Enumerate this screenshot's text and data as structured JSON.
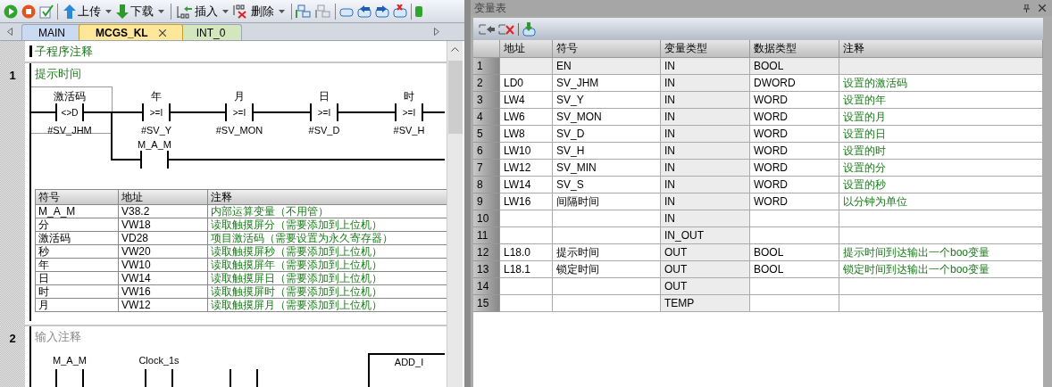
{
  "toolbar": {
    "buttons": [
      {
        "label": "上传"
      },
      {
        "label": "下载"
      },
      {
        "label": "插入"
      },
      {
        "label": "删除"
      }
    ]
  },
  "tabs": [
    {
      "label": "MAIN",
      "selected": false,
      "color": "#c9daf2"
    },
    {
      "label": "MCGS_KL",
      "selected": true,
      "color": "#ffe79a"
    },
    {
      "label": "INT_0",
      "selected": false,
      "color": "#d3e6bd"
    }
  ],
  "editor": {
    "subroutine_comment": "子程序注释",
    "networks": [
      {
        "number": "1",
        "comment": "提示时间",
        "comment_is_default": false,
        "contacts": [
          {
            "top": "激活码",
            "op": "<>D",
            "bottom": "#SV_JHM",
            "selected": true
          },
          {
            "top": "年",
            "op": ">=I",
            "bottom": "#SV_Y",
            "selected": false
          },
          {
            "top": "月",
            "op": ">=I",
            "bottom": "#SV_MON",
            "selected": false
          },
          {
            "top": "日",
            "op": ">=I",
            "bottom": "#SV_D",
            "selected": false
          },
          {
            "top": "时",
            "op": ">=I",
            "bottom": "#SV_H",
            "selected": false
          }
        ],
        "branch_contact": {
          "top": "M_A_M"
        },
        "symbol_table": {
          "columns": [
            "符号",
            "地址",
            "注释"
          ],
          "rows": [
            [
              "M_A_M",
              "V38.2",
              "内部运算变量（不用管）"
            ],
            [
              "分",
              "VW18",
              "读取触摸屏分（需要添加到上位机）"
            ],
            [
              "激活码",
              "VD28",
              "项目激活码（需要设置为永久寄存器）"
            ],
            [
              "秒",
              "VW20",
              "读取触摸屏秒（需要添加到上位机）"
            ],
            [
              "年",
              "VW10",
              "读取触摸屏年（需要添加到上位机）"
            ],
            [
              "日",
              "VW14",
              "读取触摸屏日（需要添加到上位机）"
            ],
            [
              "时",
              "VW16",
              "读取触摸屏时（需要添加到上位机）"
            ],
            [
              "月",
              "VW12",
              "读取触摸屏月（需要添加到上位机）"
            ]
          ]
        }
      },
      {
        "number": "2",
        "comment": "输入注释",
        "comment_is_default": true,
        "contact_labels": [
          "M_A_M",
          "Clock_1s"
        ],
        "box_title": "ADD_I"
      }
    ]
  },
  "variable_table": {
    "title": "变量表",
    "columns": [
      "地址",
      "符号",
      "变量类型",
      "数据类型",
      "注释"
    ],
    "rows": [
      {
        "index": "1",
        "address": "",
        "symbol": "EN",
        "var_type": "IN",
        "data_type": "BOOL",
        "comment": "",
        "editable": false
      },
      {
        "index": "2",
        "address": "LD0",
        "symbol": "SV_JHM",
        "var_type": "IN",
        "data_type": "DWORD",
        "comment": "设置的激活码",
        "editable": true
      },
      {
        "index": "3",
        "address": "LW4",
        "symbol": "SV_Y",
        "var_type": "IN",
        "data_type": "WORD",
        "comment": "设置的年",
        "editable": true
      },
      {
        "index": "4",
        "address": "LW6",
        "symbol": "SV_MON",
        "var_type": "IN",
        "data_type": "WORD",
        "comment": "设置的月",
        "editable": true
      },
      {
        "index": "5",
        "address": "LW8",
        "symbol": "SV_D",
        "var_type": "IN",
        "data_type": "WORD",
        "comment": "设置的日",
        "editable": true
      },
      {
        "index": "6",
        "address": "LW10",
        "symbol": "SV_H",
        "var_type": "IN",
        "data_type": "WORD",
        "comment": "设置的时",
        "editable": true
      },
      {
        "index": "7",
        "address": "LW12",
        "symbol": "SV_MIN",
        "var_type": "IN",
        "data_type": "WORD",
        "comment": "设置的分",
        "editable": true
      },
      {
        "index": "8",
        "address": "LW14",
        "symbol": "SV_S",
        "var_type": "IN",
        "data_type": "WORD",
        "comment": "设置的秒",
        "editable": true
      },
      {
        "index": "9",
        "address": "LW16",
        "symbol": "间隔时间",
        "var_type": "IN",
        "data_type": "WORD",
        "comment": "以分钟为单位",
        "editable": true
      },
      {
        "index": "10",
        "address": "",
        "symbol": "",
        "var_type": "IN",
        "data_type": "",
        "comment": "",
        "editable": true
      },
      {
        "index": "11",
        "address": "",
        "symbol": "",
        "var_type": "IN_OUT",
        "data_type": "",
        "comment": "",
        "editable": true
      },
      {
        "index": "12",
        "address": "L18.0",
        "symbol": "提示时间",
        "var_type": "OUT",
        "data_type": "BOOL",
        "comment": "提示时间到达输出一个boo变量",
        "editable": true
      },
      {
        "index": "13",
        "address": "L18.1",
        "symbol": "锁定时间",
        "var_type": "OUT",
        "data_type": "BOOL",
        "comment": "锁定时间到达输出一个boo变量",
        "editable": true
      },
      {
        "index": "14",
        "address": "",
        "symbol": "",
        "var_type": "OUT",
        "data_type": "",
        "comment": "",
        "editable": true
      },
      {
        "index": "15",
        "address": "",
        "symbol": "",
        "var_type": "TEMP",
        "data_type": "",
        "comment": "",
        "editable": true
      }
    ]
  }
}
